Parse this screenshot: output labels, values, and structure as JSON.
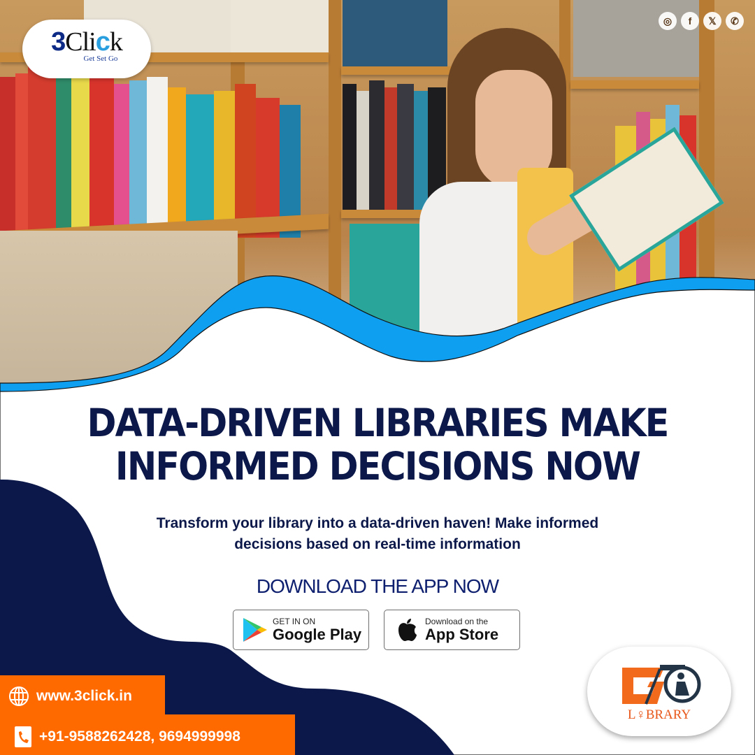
{
  "brand": {
    "logo_main": "3Click",
    "logo_tagline": "Get Set Go",
    "accent_navy": "#0b1849",
    "accent_blue": "#0f9ff0",
    "accent_orange": "#ff6a00"
  },
  "social": [
    {
      "name": "instagram",
      "glyph": "◎"
    },
    {
      "name": "facebook",
      "glyph": "f"
    },
    {
      "name": "x-twitter",
      "glyph": "𝕏"
    },
    {
      "name": "whatsapp",
      "glyph": "✆"
    }
  ],
  "headline": {
    "line1": "DATA-DRIVEN LIBRARIES MAKE",
    "line2": "INFORMED DECISIONS NOW"
  },
  "subtext": {
    "line1": "Transform your library into a data-driven haven! Make informed",
    "line2": "decisions based on real-time information"
  },
  "cta": "DOWNLOAD THE APP NOW",
  "stores": {
    "google": {
      "small": "GET IN ON",
      "big": "Google Play"
    },
    "apple": {
      "small": "Download on the",
      "big": "App Store"
    }
  },
  "contact": {
    "website": "www.3click.in",
    "phone": "+91-9588262428, 9694999998"
  },
  "app_logo": {
    "mark": "GO",
    "name": "LIBRARY"
  }
}
